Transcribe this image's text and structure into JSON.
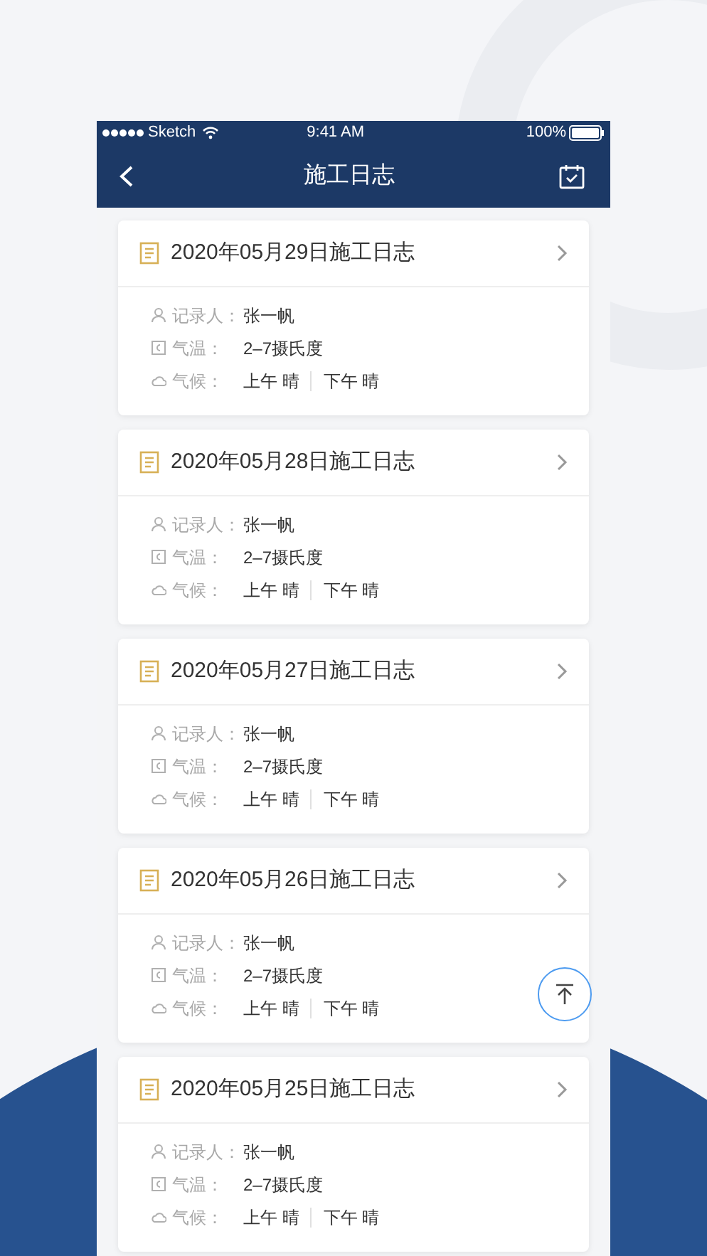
{
  "status_bar": {
    "carrier": "Sketch",
    "time": "9:41 AM",
    "battery": "100%"
  },
  "nav_bar": {
    "title": "施工日志"
  },
  "logs": [
    {
      "title": "2020年05月29日施工日志",
      "recorder_label": "记录人：",
      "recorder": "张一帆",
      "temperature_label": "气温：",
      "temperature": "2–7摄氏度",
      "weather_label": "气候：",
      "weather_am": "上午 晴",
      "weather_pm": "下午 晴"
    },
    {
      "title": "2020年05月28日施工日志",
      "recorder_label": "记录人：",
      "recorder": "张一帆",
      "temperature_label": "气温：",
      "temperature": "2–7摄氏度",
      "weather_label": "气候：",
      "weather_am": "上午 晴",
      "weather_pm": "下午 晴"
    },
    {
      "title": "2020年05月27日施工日志",
      "recorder_label": "记录人：",
      "recorder": "张一帆",
      "temperature_label": "气温：",
      "temperature": "2–7摄氏度",
      "weather_label": "气候：",
      "weather_am": "上午 晴",
      "weather_pm": "下午 晴"
    },
    {
      "title": "2020年05月26日施工日志",
      "recorder_label": "记录人：",
      "recorder": "张一帆",
      "temperature_label": "气温：",
      "temperature": "2–7摄氏度",
      "weather_label": "气候：",
      "weather_am": "上午 晴",
      "weather_pm": "下午 晴"
    },
    {
      "title": "2020年05月25日施工日志",
      "recorder_label": "记录人：",
      "recorder": "张一帆",
      "temperature_label": "气温：",
      "temperature": "2–7摄氏度",
      "weather_label": "气候：",
      "weather_am": "上午 晴",
      "weather_pm": "下午 晴"
    }
  ]
}
